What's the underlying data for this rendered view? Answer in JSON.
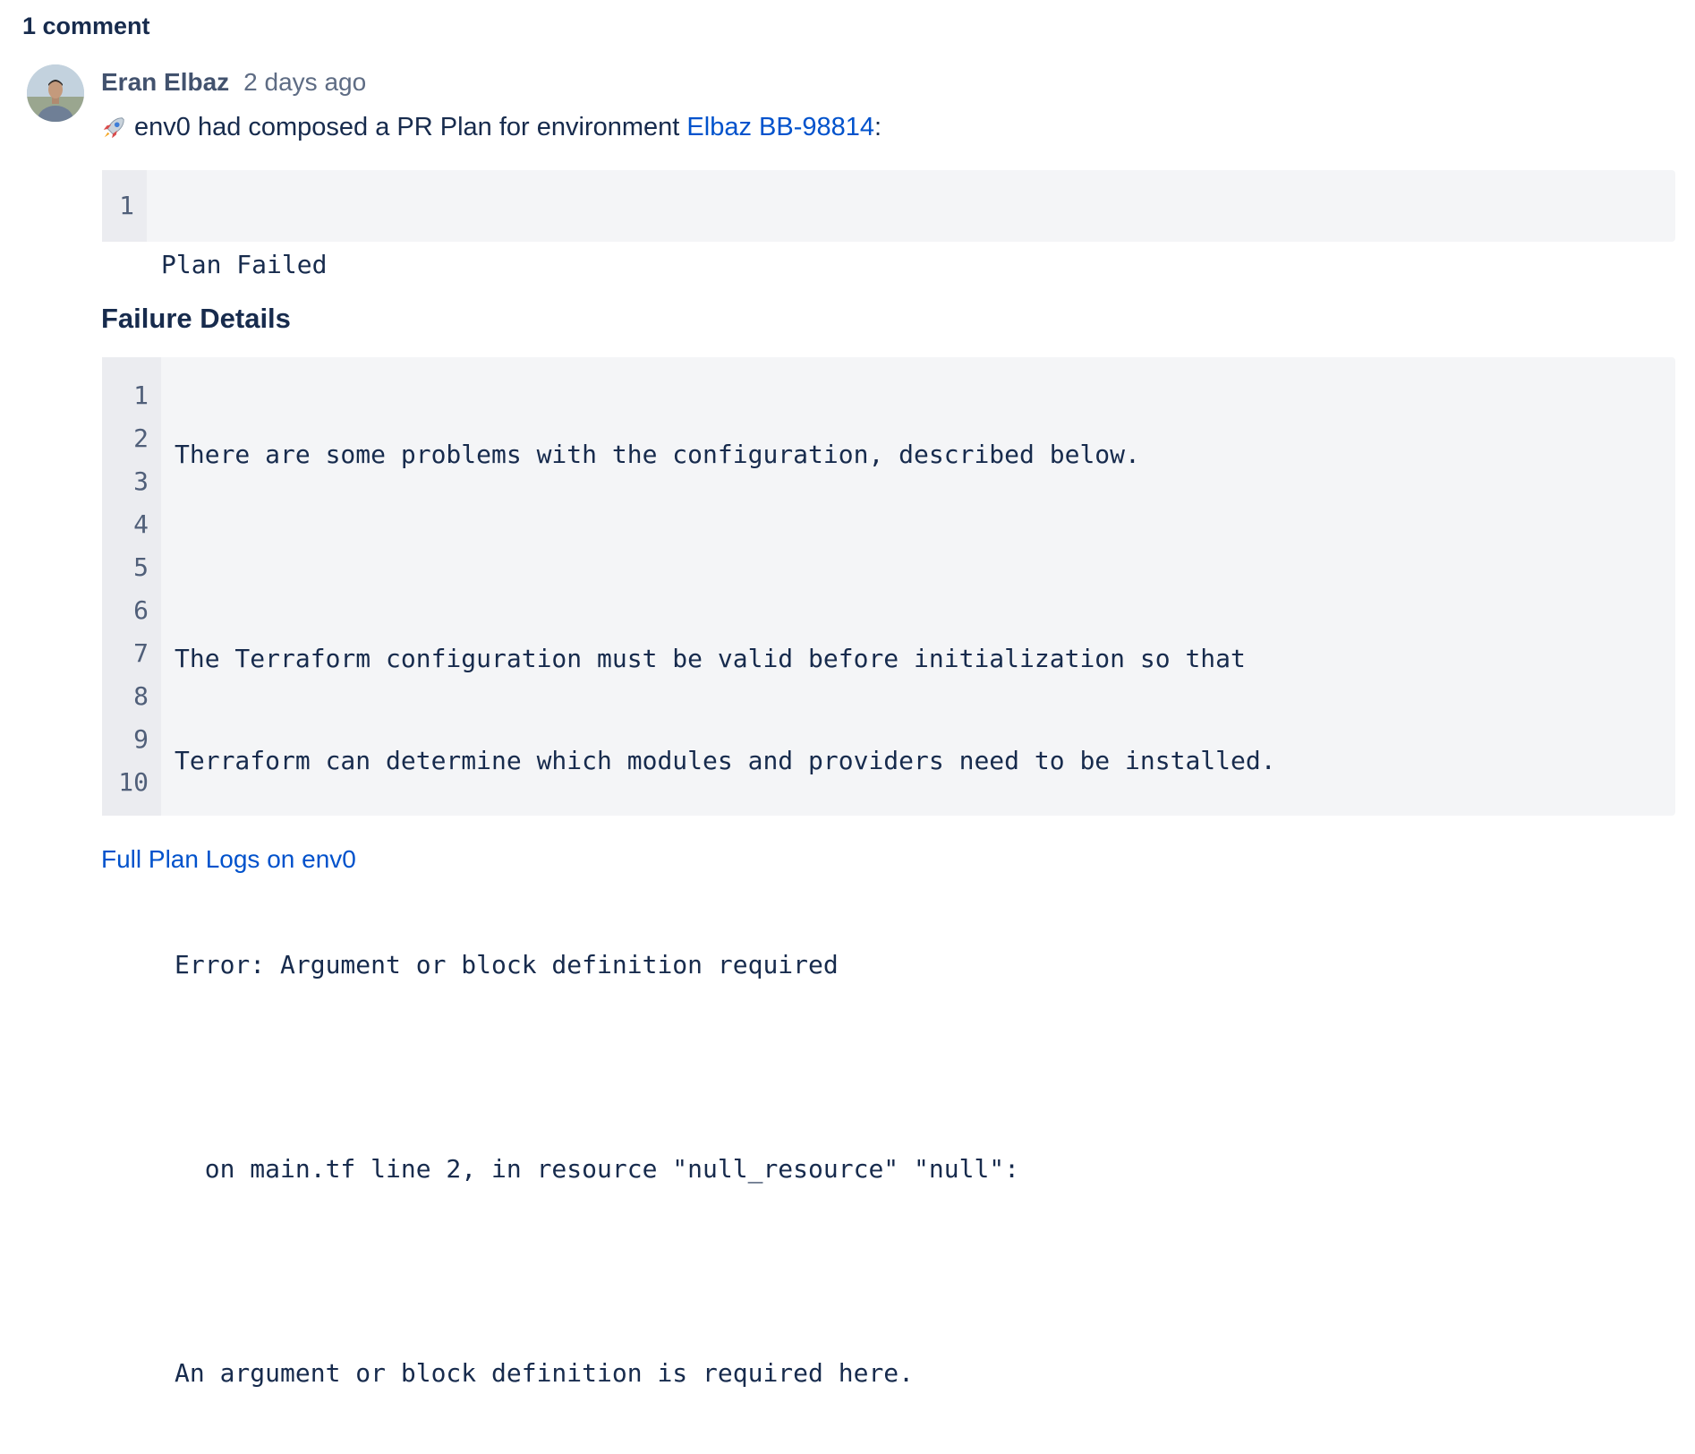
{
  "comments": {
    "heading": "1 comment"
  },
  "comment": {
    "author": "Eran Elbaz",
    "timestamp": "2 days ago",
    "rocket_icon": "rocket-emoji",
    "message_prefix": "env0 had composed a PR Plan for environment",
    "environment_link": "Elbaz BB-98814",
    "message_suffix": ":",
    "plan_status_block": {
      "lines": [
        {
          "num": "1",
          "text": "Plan Failed"
        }
      ]
    },
    "failure_heading": "Failure Details",
    "failure_block": {
      "lines": [
        {
          "num": "1",
          "text": "There are some problems with the configuration, described below."
        },
        {
          "num": "2",
          "text": ""
        },
        {
          "num": "3",
          "text": "The Terraform configuration must be valid before initialization so that"
        },
        {
          "num": "4",
          "text": "Terraform can determine which modules and providers need to be installed."
        },
        {
          "num": "5",
          "text": ""
        },
        {
          "num": "6",
          "text": "Error: Argument or block definition required"
        },
        {
          "num": "7",
          "text": ""
        },
        {
          "num": "8",
          "text": "  on main.tf line 2, in resource \"null_resource\" \"null\":"
        },
        {
          "num": "9",
          "text": ""
        },
        {
          "num": "10",
          "text": "An argument or block definition is required here."
        }
      ]
    },
    "full_logs_link": "Full Plan Logs on env0"
  },
  "colors": {
    "link": "#0052cc",
    "text": "#172b4d",
    "code_bg": "#f4f5f7",
    "gutter_bg": "#ebecf0"
  }
}
